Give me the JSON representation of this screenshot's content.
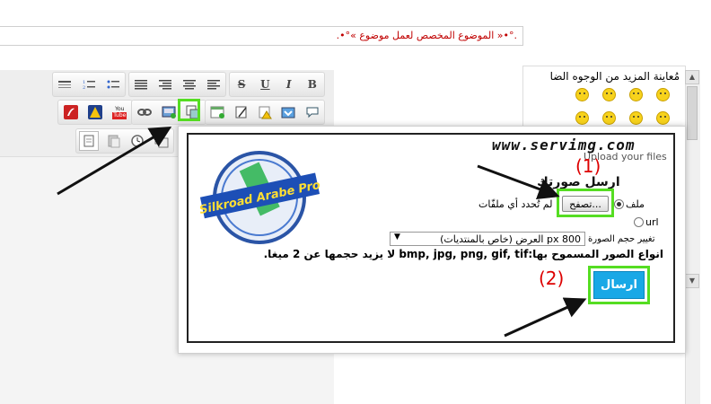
{
  "subject": {
    "value": ".°•« الموضوع المخصص لعمل موضوع »°•."
  },
  "smilies": {
    "title": "مُعاينة المزيد من الوجوه الضا"
  },
  "popup": {
    "logo": "www.servimg.com",
    "tagline": "Upload your files",
    "badge_text": "Silkroad Arabe Pro",
    "title": "ارسل صورتك",
    "step1": "(1)",
    "step2": "(2)",
    "file_label": "ملف",
    "browse_label": "تصفح...",
    "no_file": "لم تُحدد أي ملفّات",
    "url_label": "url",
    "resize_label": "تغيير حجم الصورة",
    "resize_selected": "800 px العرض (خاص بالمنتديات)",
    "formats_prefix": "انواع الصور المسموح بها:",
    "formats_list": "bmp, jpg, png, gif, tif",
    "formats_suffix": " لا يزيد حجمها عن 2 ميغا.",
    "submit_label": "ارسال"
  },
  "toolbar": {
    "bold": "B",
    "italic": "I",
    "underline": "U",
    "strike": "S",
    "youtube_top": "You",
    "youtube_bottom": "Tube"
  },
  "colors": {
    "highlight": "#55dd22",
    "submit": "#19a8e6",
    "step_label": "#dd0000",
    "subject_text": "#c00000"
  }
}
